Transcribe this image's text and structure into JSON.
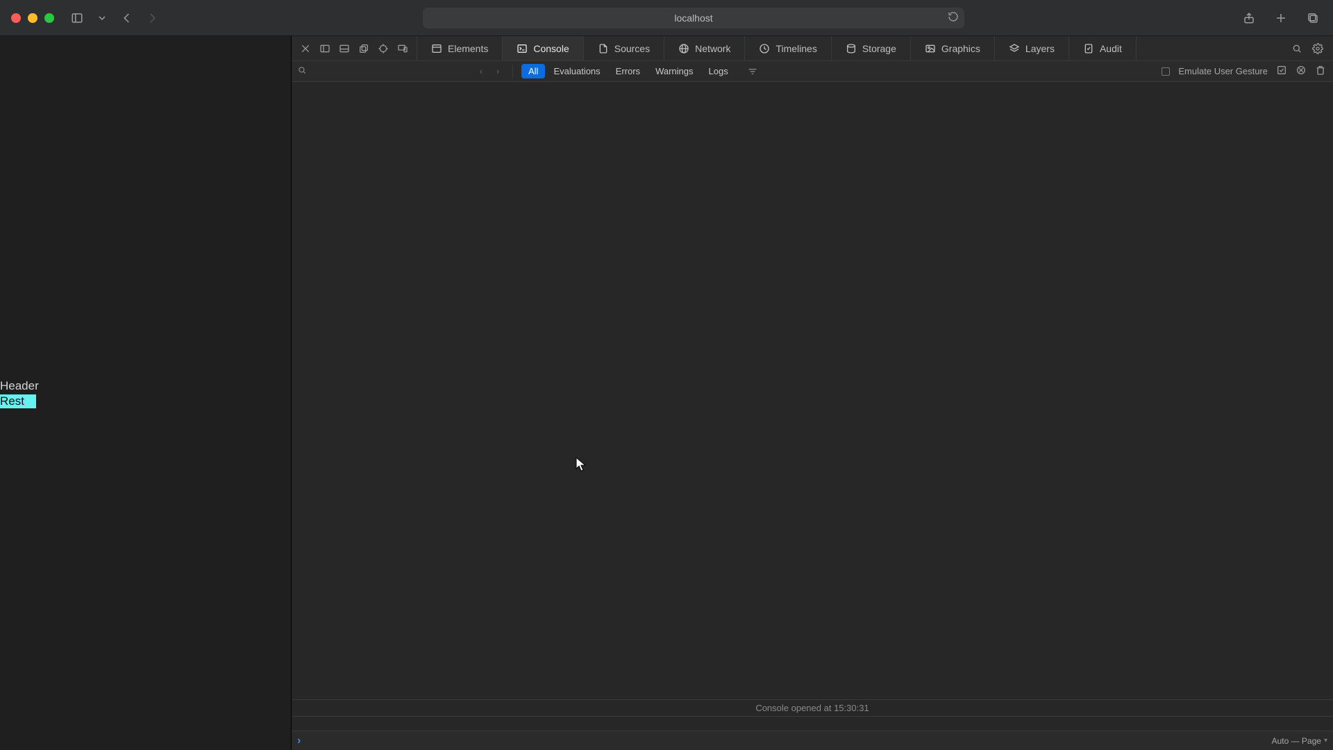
{
  "titlebar": {
    "address": "localhost"
  },
  "page": {
    "header_text": "Header",
    "rest_text": "Rest"
  },
  "devtools": {
    "tabs": {
      "elements": "Elements",
      "console": "Console",
      "sources": "Sources",
      "network": "Network",
      "timelines": "Timelines",
      "storage": "Storage",
      "graphics": "Graphics",
      "layers": "Layers",
      "audit": "Audit"
    },
    "filters": {
      "all": "All",
      "evaluations": "Evaluations",
      "errors": "Errors",
      "warnings": "Warnings",
      "logs": "Logs"
    },
    "emulate_label": "Emulate User Gesture",
    "console_opened_text": "Console opened at 15:30:31",
    "exec_context": "Auto — Page"
  }
}
